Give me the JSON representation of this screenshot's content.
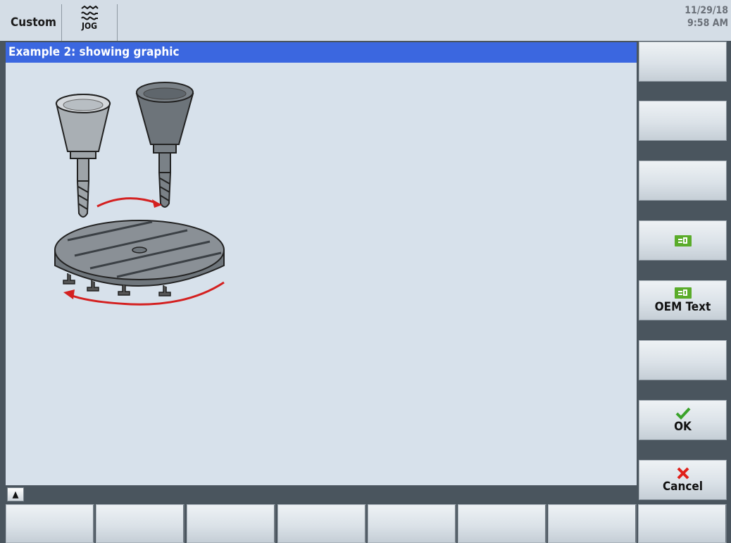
{
  "topbar": {
    "area_label": "Custom",
    "mode_label": "JOG",
    "date": "11/29/18",
    "time": "9:58 AM"
  },
  "header": {
    "title": "Example 2: showing graphic"
  },
  "graphic": {
    "icon": "rotary-table-tool-change-graphic"
  },
  "scroll": {
    "icon": "chevron-up-icon"
  },
  "vertical_softkeys": [
    {
      "label": "",
      "icon": ""
    },
    {
      "label": "",
      "icon": ""
    },
    {
      "label": "",
      "icon": ""
    },
    {
      "label": "",
      "icon": "oem-icon"
    },
    {
      "label": "OEM Text",
      "icon": "oem-icon"
    },
    {
      "label": "",
      "icon": ""
    },
    {
      "label": "OK",
      "icon": "checkmark-icon"
    },
    {
      "label": "Cancel",
      "icon": "cross-icon"
    }
  ],
  "horizontal_softkeys": [
    "",
    "",
    "",
    "",
    "",
    "",
    "",
    ""
  ],
  "colors": {
    "header_bg": "#3b67e0",
    "content_bg": "#d7e1eb",
    "frame": "#4a555e",
    "ok_green": "#3aa32a",
    "cancel_red": "#e0201a",
    "oem_green": "#5aac2a"
  }
}
